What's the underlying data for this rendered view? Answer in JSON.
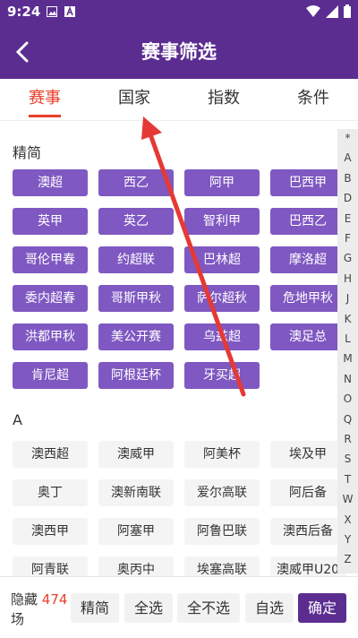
{
  "status": {
    "time": "9:24"
  },
  "header": {
    "title": "赛事筛选"
  },
  "tabs": [
    {
      "label": "赛事",
      "active": true
    },
    {
      "label": "国家",
      "active": false
    },
    {
      "label": "指数",
      "active": false
    },
    {
      "label": "条件",
      "active": false
    }
  ],
  "sections": {
    "featured": {
      "title": "精简",
      "items": [
        "澳超",
        "西乙",
        "阿甲",
        "巴西甲",
        "英甲",
        "英乙",
        "智利甲",
        "巴西乙",
        "哥伦甲春",
        "约超联",
        "巴林超",
        "摩洛超",
        "委内超春",
        "哥斯甲秋",
        "萨尔超秋",
        "危地甲秋",
        "洪都甲秋",
        "美公开赛",
        "乌兹超",
        "澳足总",
        "肯尼超",
        "阿根廷杯",
        "牙买超"
      ]
    },
    "a": {
      "title": "A",
      "items": [
        "澳西超",
        "澳威甲",
        "阿美杯",
        "埃及甲",
        "奥丁",
        "澳新南联",
        "爱尔高联",
        "阿后备",
        "澳西甲",
        "阿塞甲",
        "阿鲁巴联",
        "澳西后备",
        "阿青联",
        "奥丙中",
        "埃塞高联",
        "澳威甲U20"
      ]
    }
  },
  "alphabet": [
    "*",
    "A",
    "B",
    "D",
    "E",
    "F",
    "G",
    "H",
    "J",
    "K",
    "L",
    "M",
    "N",
    "O",
    "Q",
    "R",
    "S",
    "T",
    "W",
    "X",
    "Y",
    "Z"
  ],
  "bottom": {
    "hidden_prefix": "隐藏",
    "hidden_count": "474",
    "hidden_suffix": "场",
    "buttons": {
      "simplified": "精简",
      "select_all": "全选",
      "select_none": "全不选",
      "custom": "自选",
      "confirm": "确定"
    }
  },
  "colors": {
    "brand": "#5b2d91",
    "chip_selected": "#7f58c2",
    "accent": "#e8402b"
  }
}
